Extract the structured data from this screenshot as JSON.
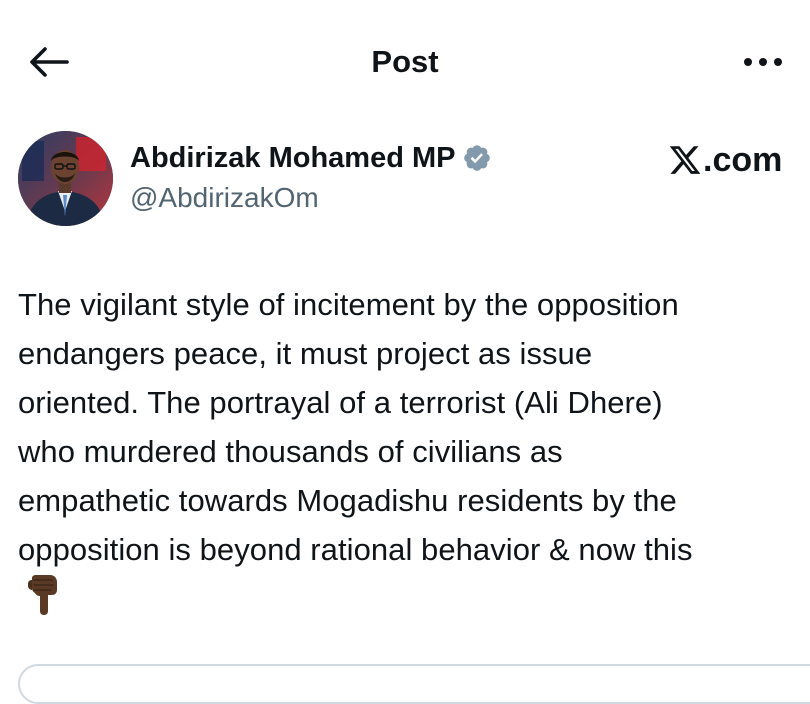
{
  "header": {
    "title": "Post",
    "back_icon": "arrow-left-icon",
    "more_icon": "more-horizontal-icon"
  },
  "author": {
    "name": "Abdirizak Mohamed MP",
    "handle": "@AbdirizakOm",
    "verified": true,
    "verified_color": "#829aab"
  },
  "brand": {
    "text": ".com",
    "icon": "x-logo-icon"
  },
  "post": {
    "lines": [
      "The vigilant style of incitement by the opposition",
      "endangers peace, it must project as issue",
      "oriented. The portrayal of a terrorist (Ali Dhere)",
      "who murdered thousands of civilians as",
      "empathetic towards Mogadishu residents by the",
      "opposition is beyond rational behavior & now this"
    ],
    "emoji": "backhand-index-pointing-down-icon"
  },
  "colors": {
    "text_primary": "#0f1419",
    "text_secondary": "#536471",
    "border": "#cfd9de"
  }
}
